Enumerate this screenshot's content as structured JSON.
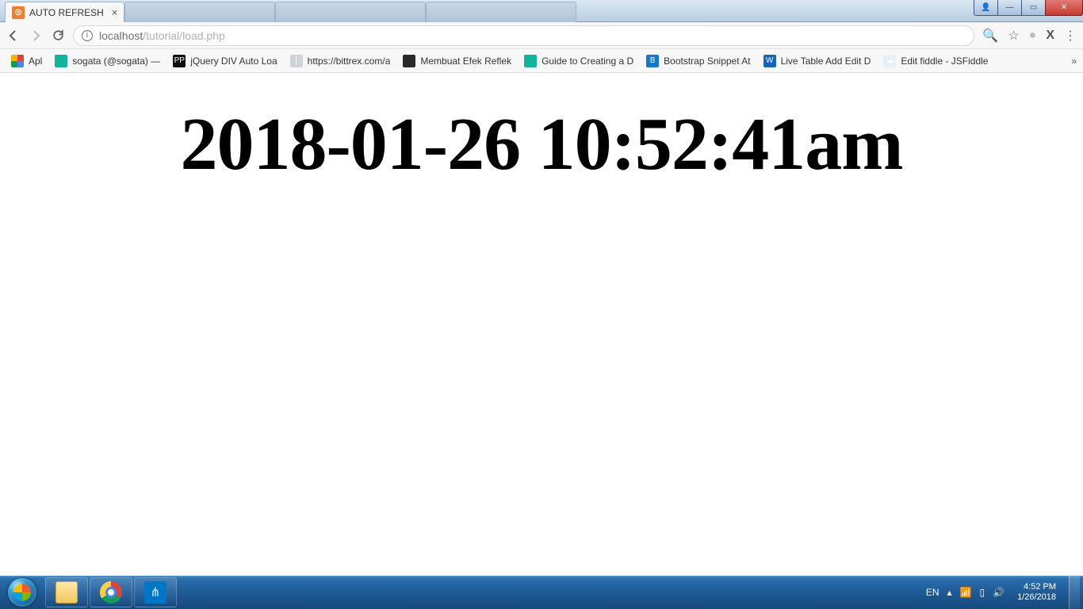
{
  "window": {
    "controls": {
      "user": "👤",
      "min": "—",
      "max": "▭",
      "close": "✕"
    }
  },
  "tabs": {
    "active_title": "AUTO REFRESH"
  },
  "addr": {
    "host": "localhost",
    "path": "/tutorial/load.php"
  },
  "bookmarks": {
    "apps": "Apl",
    "items": [
      "sogata (@sogata) —",
      "jQuery DIV Auto Loa",
      "https://bittrex.com/a",
      "Membuat Efek Reflek",
      "Guide to Creating a D",
      "Bootstrap Snippet At",
      "Live Table Add Edit D",
      "Edit fiddle - JSFiddle"
    ]
  },
  "page": {
    "heading": "2018-01-26 10:52:41am"
  },
  "taskbar": {
    "lang": "EN",
    "time": "4:52 PM",
    "date": "1/26/2018"
  }
}
